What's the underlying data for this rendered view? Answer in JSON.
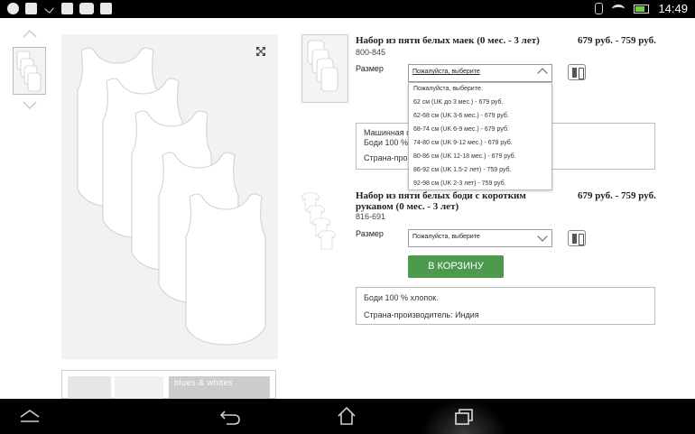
{
  "status_bar": {
    "time": "14:49",
    "notification_icons": [
      "chrome-icon",
      "doc-icon",
      "check-icon",
      "image-icon",
      "youtube-icon",
      "bag-icon"
    ],
    "battery_color": "#6fcf3f"
  },
  "gallery": {
    "strip_text": "blues & whites"
  },
  "product1": {
    "title": "Набор из пяти белых маек (0 мес. - 3 лет)",
    "code": "800-845",
    "price": "679 руб. - 759 руб.",
    "size_label": "Размер",
    "select_value": "Пожалуйста, выберите",
    "dropdown_options": [
      "Пожалуйста, выберите",
      "62 см (UK до 3 мес.) - 679 руб.",
      "62-68 см (UK 3-6 мес.) - 679 руб.",
      "68-74 см (UK 6-9 мес.) - 679 руб.",
      "74-80 см (UK 9-12 мес.) - 679 руб.",
      "80-86 см (UK 12-18 мес.) - 679 руб.",
      "86-92 см (UK 1.5-2 лет) - 759 руб.",
      "92-98 см (UK 2-3 лет) - 759 руб."
    ],
    "info_line1": "Машинная ст",
    "info_line2": "Боди 100 % х",
    "info_line3": "Страна-произ"
  },
  "product2": {
    "title": "Набор из пяти белых боди с коротким рукавом (0 мес. - 3 лет)",
    "code": "816-691",
    "price": "679 руб. - 759 руб.",
    "size_label": "Размер",
    "select_value": "Пожалуйста, выберите",
    "cart_button": "В КОРЗИНУ",
    "info_line1": "Боди 100 % хлопок.",
    "info_line2": "Страна-производитель: Индия"
  },
  "colors": {
    "accent_green": "#4d9a4f"
  }
}
